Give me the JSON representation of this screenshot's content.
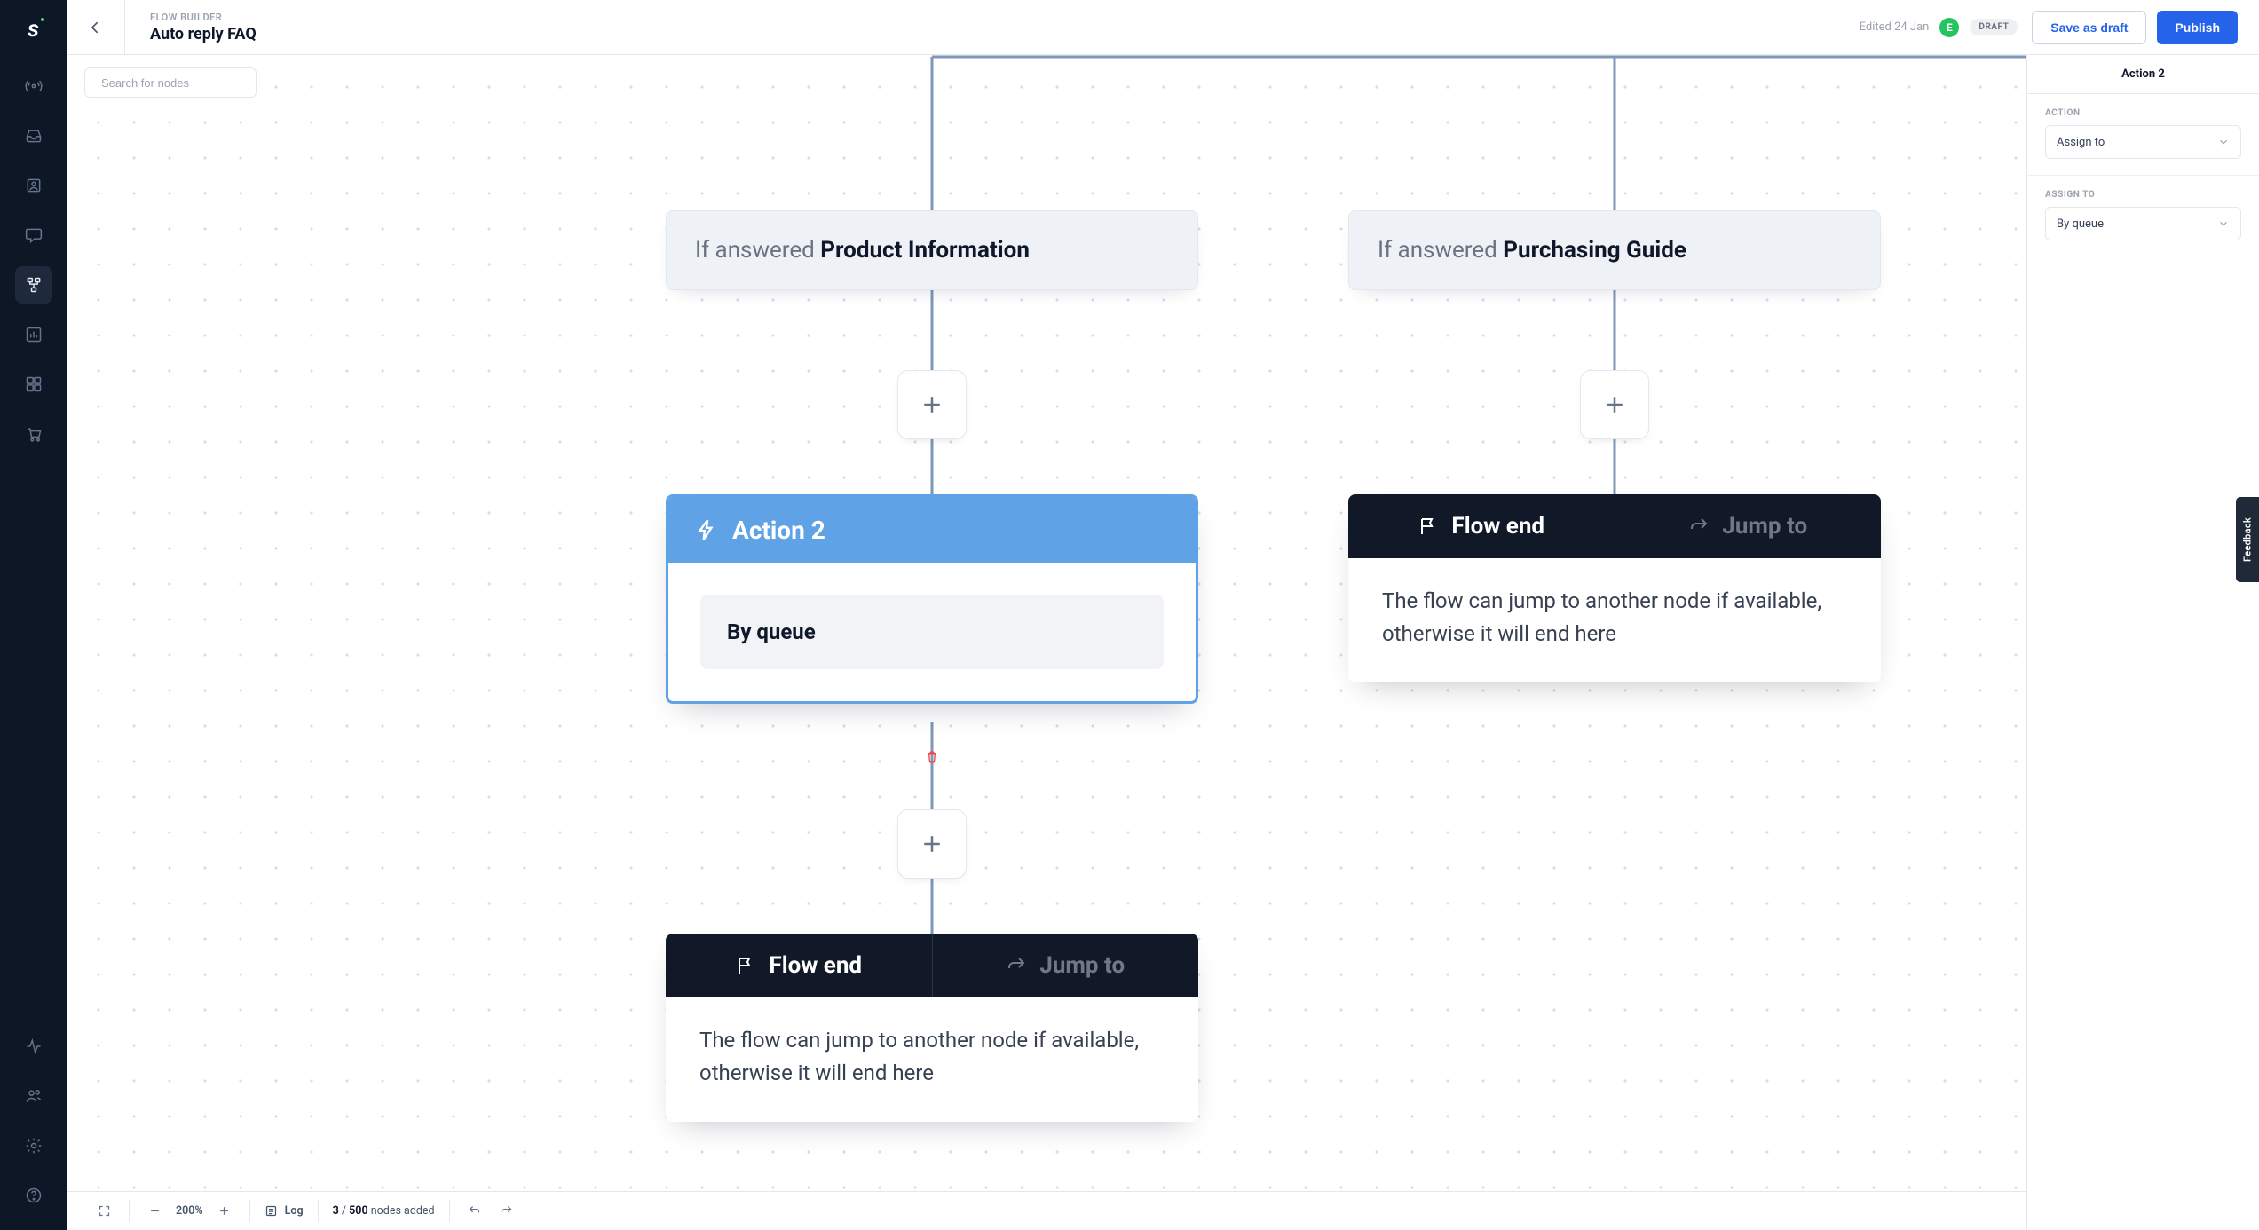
{
  "header": {
    "eyebrow": "FLOW BUILDER",
    "title": "Auto reply FAQ",
    "edited": "Edited 24 Jan",
    "avatar_initial": "E",
    "draft_chip": "DRAFT",
    "save_draft": "Save as draft",
    "publish": "Publish"
  },
  "search": {
    "placeholder": "Search for nodes"
  },
  "nodes": {
    "cond1_prefix": "If answered ",
    "cond1_value": "Product Information",
    "cond2_prefix": "If answered ",
    "cond2_value": "Purchasing Guide",
    "action_title": "Action 2",
    "action_value": "By queue",
    "flow_end_label": "Flow end",
    "jump_to_label": "Jump to",
    "end_body": "The flow can jump to another node if available, otherwise it will end here"
  },
  "inspector": {
    "title": "Action 2",
    "action_label": "ACTION",
    "action_value": "Assign to",
    "assign_label": "ASSIGN TO",
    "assign_value": "By queue"
  },
  "footer": {
    "zoom": "200%",
    "log": "Log",
    "count_current": "3",
    "count_sep": " / ",
    "count_total": "500",
    "count_suffix": " nodes added"
  },
  "feedback": "Feedback"
}
